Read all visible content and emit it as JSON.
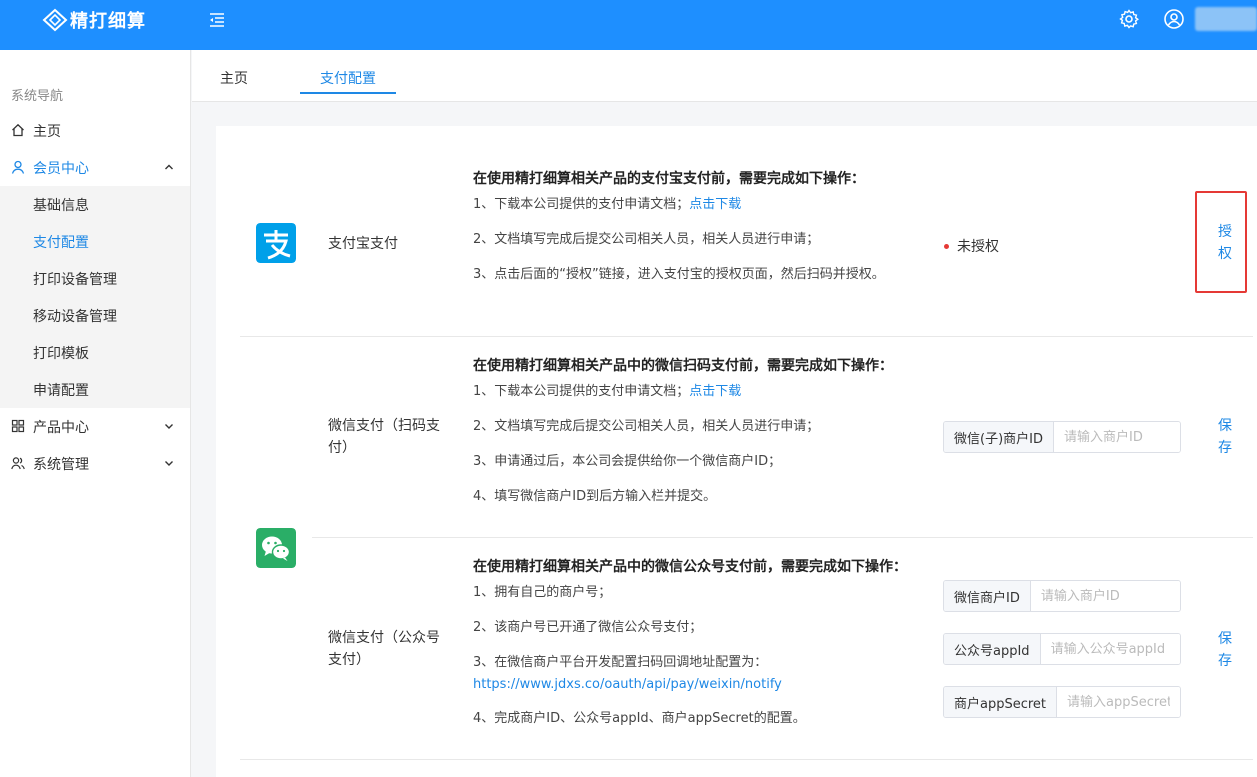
{
  "app": {
    "logo_text": "精打细算"
  },
  "sidebar": {
    "title": "系统导航",
    "items": [
      {
        "label": "主页"
      },
      {
        "label": "会员中心"
      },
      {
        "label": "产品中心"
      },
      {
        "label": "系统管理"
      }
    ],
    "member_sub": [
      {
        "label": "基础信息"
      },
      {
        "label": "支付配置"
      },
      {
        "label": "打印设备管理"
      },
      {
        "label": "移动设备管理"
      },
      {
        "label": "打印模板"
      },
      {
        "label": "申请配置"
      }
    ]
  },
  "tabs": [
    {
      "label": "主页"
    },
    {
      "label": "支付配置"
    }
  ],
  "alipay": {
    "name": "支付宝支付",
    "title": "在使用精打细算相关产品的支付宝支付前，需要完成如下操作：",
    "step1_text": "1、下载本公司提供的支付申请文档；",
    "step1_link": "点击下载",
    "step2": "2、文档填写完成后提交公司相关人员，相关人员进行申请；",
    "step3": "3、点击后面的“授权”链接，进入支付宝的授权页面，然后扫码并授权。",
    "status": "未授权",
    "action": "授权"
  },
  "wechat_scan": {
    "name": "微信支付（扫码支付）",
    "title": "在使用精打细算相关产品中的微信扫码支付前，需要完成如下操作：",
    "step1_text": "1、下载本公司提供的支付申请文档；",
    "step1_link": "点击下载",
    "step2": "2、文档填写完成后提交公司相关人员，相关人员进行申请；",
    "step3": "3、申请通过后，本公司会提供给你一个微信商户ID；",
    "step4": "4、填写微信商户ID到后方输入栏并提交。",
    "field_label": "微信(子)商户ID",
    "field_placeholder": "请输入商户ID",
    "action": "保存"
  },
  "wechat_mp": {
    "name": "微信支付（公众号支付）",
    "title": "在使用精打细算相关产品中的微信公众号支付前，需要完成如下操作：",
    "step1": "1、拥有自己的商户号；",
    "step2": "2、该商户号已开通了微信公众号支付；",
    "step3": "3、在微信商户平台开发配置扫码回调地址配置为：",
    "step3_link": "https://www.jdxs.co/oauth/api/pay/weixin/notify",
    "step4": "4、完成商户ID、公众号appId、商户appSecret的配置。",
    "fields": [
      {
        "label": "微信商户ID",
        "placeholder": "请输入商户ID"
      },
      {
        "label": "公众号appId",
        "placeholder": "请输入公众号appId"
      },
      {
        "label": "商户appSecret",
        "placeholder": "请输入appSecret"
      }
    ],
    "action": "保存"
  },
  "colors": {
    "primary": "#1e8fff",
    "link": "#1e88e5",
    "alipay": "#00a0e9",
    "wechat": "#2aae67",
    "highlight": "#e53935"
  }
}
